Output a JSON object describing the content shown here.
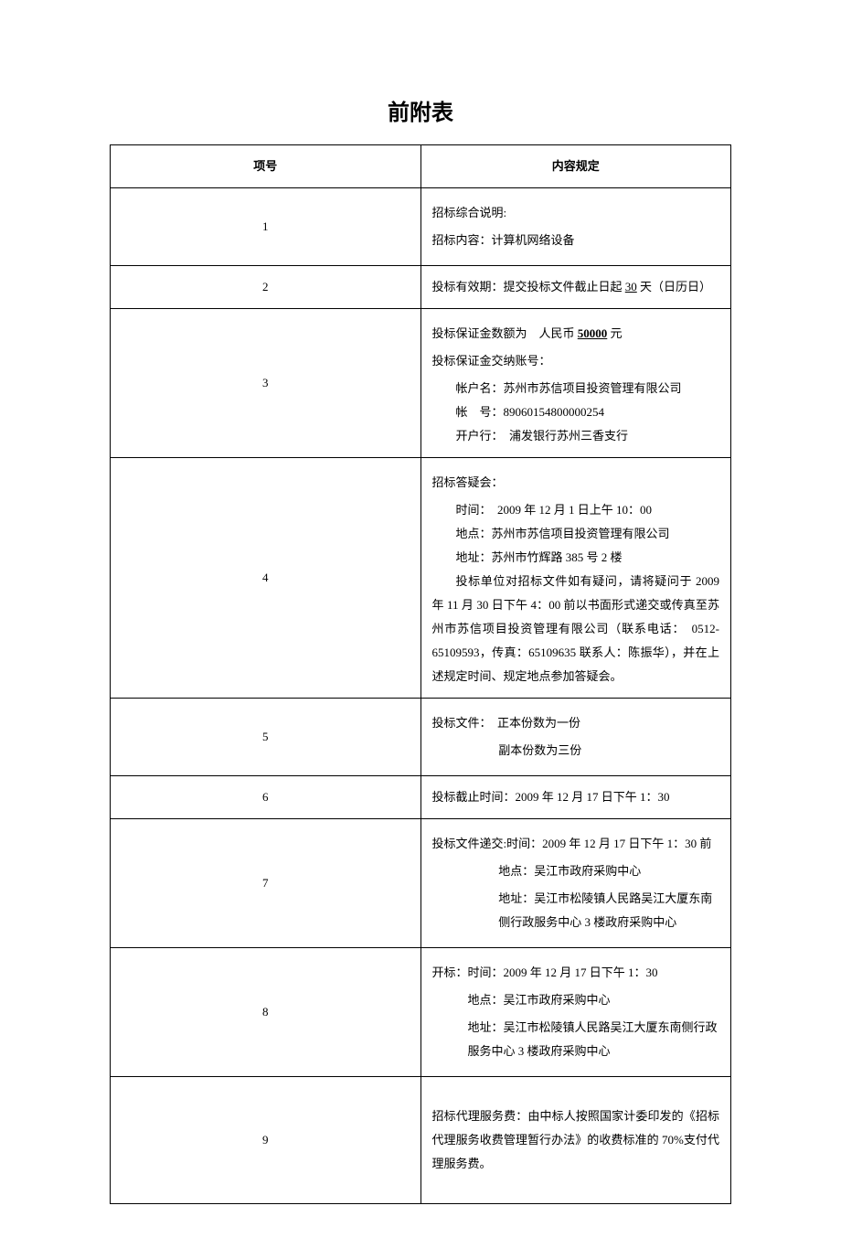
{
  "title": "前附表",
  "header": {
    "col1": "项号",
    "col2": "内容规定"
  },
  "rows": {
    "r1": {
      "num": "1",
      "line1": "招标综合说明:",
      "line2": "招标内容：计算机网络设备"
    },
    "r2": {
      "num": "2",
      "prefix": "投标有效期：提交投标文件截止日起 ",
      "days": "30",
      "suffix": " 天（日历日）"
    },
    "r3": {
      "num": "3",
      "line1a": "投标保证金数额为　人民币 ",
      "amount": "50000",
      "line1b": " 元",
      "line2": "投标保证金交纳账号：",
      "acct_name": "帐户名：苏州市苏信项目投资管理有限公司",
      "acct_no": "帐　号：89060154800000254",
      "bank": "开户行：　浦发银行苏州三香支行"
    },
    "r4": {
      "num": "4",
      "line1": "招标答疑会：",
      "time": "时间：　2009 年 12 月 1 日上午 10：00",
      "place": "地点：苏州市苏信项目投资管理有限公司",
      "addr": "地址：苏州市竹辉路 385 号 2 楼",
      "para": "投标单位对招标文件如有疑问，请将疑问于 2009 年 11 月 30 日下午 4：00 前以书面形式递交或传真至苏州市苏信项目投资管理有限公司（联系电话：　0512-65109593，传真：65109635 联系人：陈振华），并在上述规定时间、规定地点参加答疑会。"
    },
    "r5": {
      "num": "5",
      "line1": "投标文件：　正本份数为一份",
      "line2": "副本份数为三份"
    },
    "r6": {
      "num": "6",
      "text": "投标截止时间：2009 年 12 月 17 日下午 1：30"
    },
    "r7": {
      "num": "7",
      "line1": "投标文件递交:时间：2009 年 12 月 17 日下午 1：30 前",
      "line2": "地点：吴江市政府采购中心",
      "line3": "地址：吴江市松陵镇人民路吴江大厦东南侧行政服务中心 3 楼政府采购中心"
    },
    "r8": {
      "num": "8",
      "line1": "开标：时间：2009 年 12 月 17 日下午 1：30",
      "line2": "地点：吴江市政府采购中心",
      "line3": "地址：吴江市松陵镇人民路吴江大厦东南侧行政服务中心 3 楼政府采购中心"
    },
    "r9": {
      "num": "9",
      "text": "招标代理服务费：由中标人按照国家计委印发的《招标代理服务收费管理暂行办法》的收费标准的 70%支付代理服务费。"
    }
  }
}
